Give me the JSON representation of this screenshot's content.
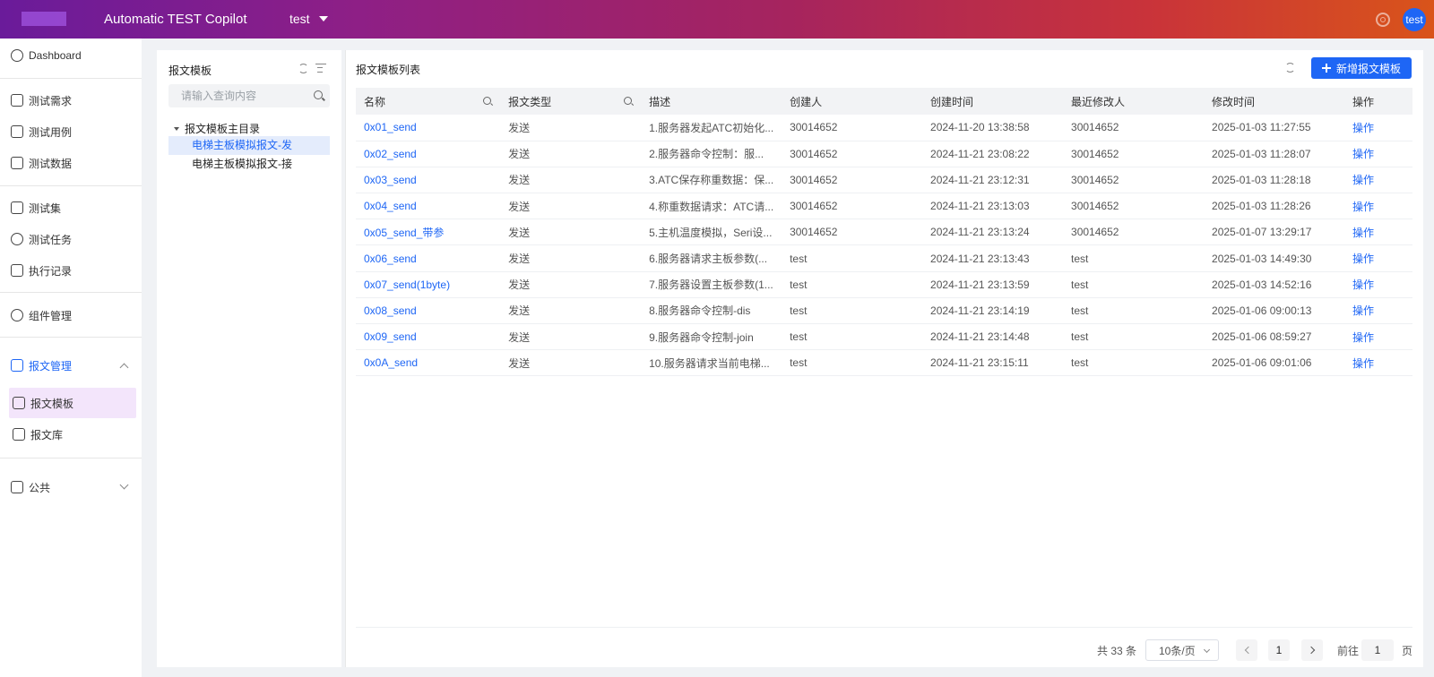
{
  "header": {
    "app_title": "Automatic TEST Copilot",
    "project": "test",
    "avatar_text": "test"
  },
  "sidebar": {
    "items": [
      {
        "label": "Dashboard"
      },
      {
        "label": "测试需求"
      },
      {
        "label": "测试用例"
      },
      {
        "label": "测试数据"
      },
      {
        "label": "测试集"
      },
      {
        "label": "测试任务"
      },
      {
        "label": "执行记录"
      },
      {
        "label": "组件管理"
      },
      {
        "label": "报文管理"
      },
      {
        "label": "报文模板"
      },
      {
        "label": "报文库"
      },
      {
        "label": "公共"
      }
    ]
  },
  "tree": {
    "title": "报文模板",
    "search_placeholder": "请输入查询内容",
    "root": "报文模板主目录",
    "nodes": [
      "电梯主板模拟报文-发",
      "电梯主板模拟报文-接"
    ]
  },
  "main": {
    "title": "报文模板列表",
    "add_button": "新增报文模板",
    "columns": [
      "名称",
      "报文类型",
      "描述",
      "创建人",
      "创建时间",
      "最近修改人",
      "修改时间",
      "操作"
    ],
    "rows": [
      [
        "0x01_send",
        "发送",
        "1.服务器发起ATC初始化...",
        "30014652",
        "2024-11-20 13:38:58",
        "30014652",
        "2025-01-03 11:27:55",
        "操作"
      ],
      [
        "0x02_send",
        "发送",
        "2.服务器命令控制：服...",
        "30014652",
        "2024-11-21 23:08:22",
        "30014652",
        "2025-01-03 11:28:07",
        "操作"
      ],
      [
        "0x03_send",
        "发送",
        "3.ATC保存称重数据：保...",
        "30014652",
        "2024-11-21 23:12:31",
        "30014652",
        "2025-01-03 11:28:18",
        "操作"
      ],
      [
        "0x04_send",
        "发送",
        "4.称重数据请求：ATC请...",
        "30014652",
        "2024-11-21 23:13:03",
        "30014652",
        "2025-01-03 11:28:26",
        "操作"
      ],
      [
        "0x05_send_带参",
        "发送",
        "5.主机温度模拟，Seri设...",
        "30014652",
        "2024-11-21 23:13:24",
        "30014652",
        "2025-01-07 13:29:17",
        "操作"
      ],
      [
        "0x06_send",
        "发送",
        "6.服务器请求主板参数(...",
        "test",
        "2024-11-21 23:13:43",
        "test",
        "2025-01-03 14:49:30",
        "操作"
      ],
      [
        "0x07_send(1byte)",
        "发送",
        "7.服务器设置主板参数(1...",
        "test",
        "2024-11-21 23:13:59",
        "test",
        "2025-01-03 14:52:16",
        "操作"
      ],
      [
        "0x08_send",
        "发送",
        "8.服务器命令控制-dis",
        "test",
        "2024-11-21 23:14:19",
        "test",
        "2025-01-06 09:00:13",
        "操作"
      ],
      [
        "0x09_send",
        "发送",
        "9.服务器命令控制-join",
        "test",
        "2024-11-21 23:14:48",
        "test",
        "2025-01-06 08:59:27",
        "操作"
      ],
      [
        "0x0A_send",
        "发送",
        "10.服务器请求当前电梯...",
        "test",
        "2024-11-21 23:15:11",
        "test",
        "2025-01-06 09:01:06",
        "操作"
      ]
    ]
  },
  "pagination": {
    "total": "共 33 条",
    "page_size": "10条/页",
    "current_page": "1",
    "goto_label": "前往",
    "goto_value": "1",
    "goto_suffix": "页"
  }
}
